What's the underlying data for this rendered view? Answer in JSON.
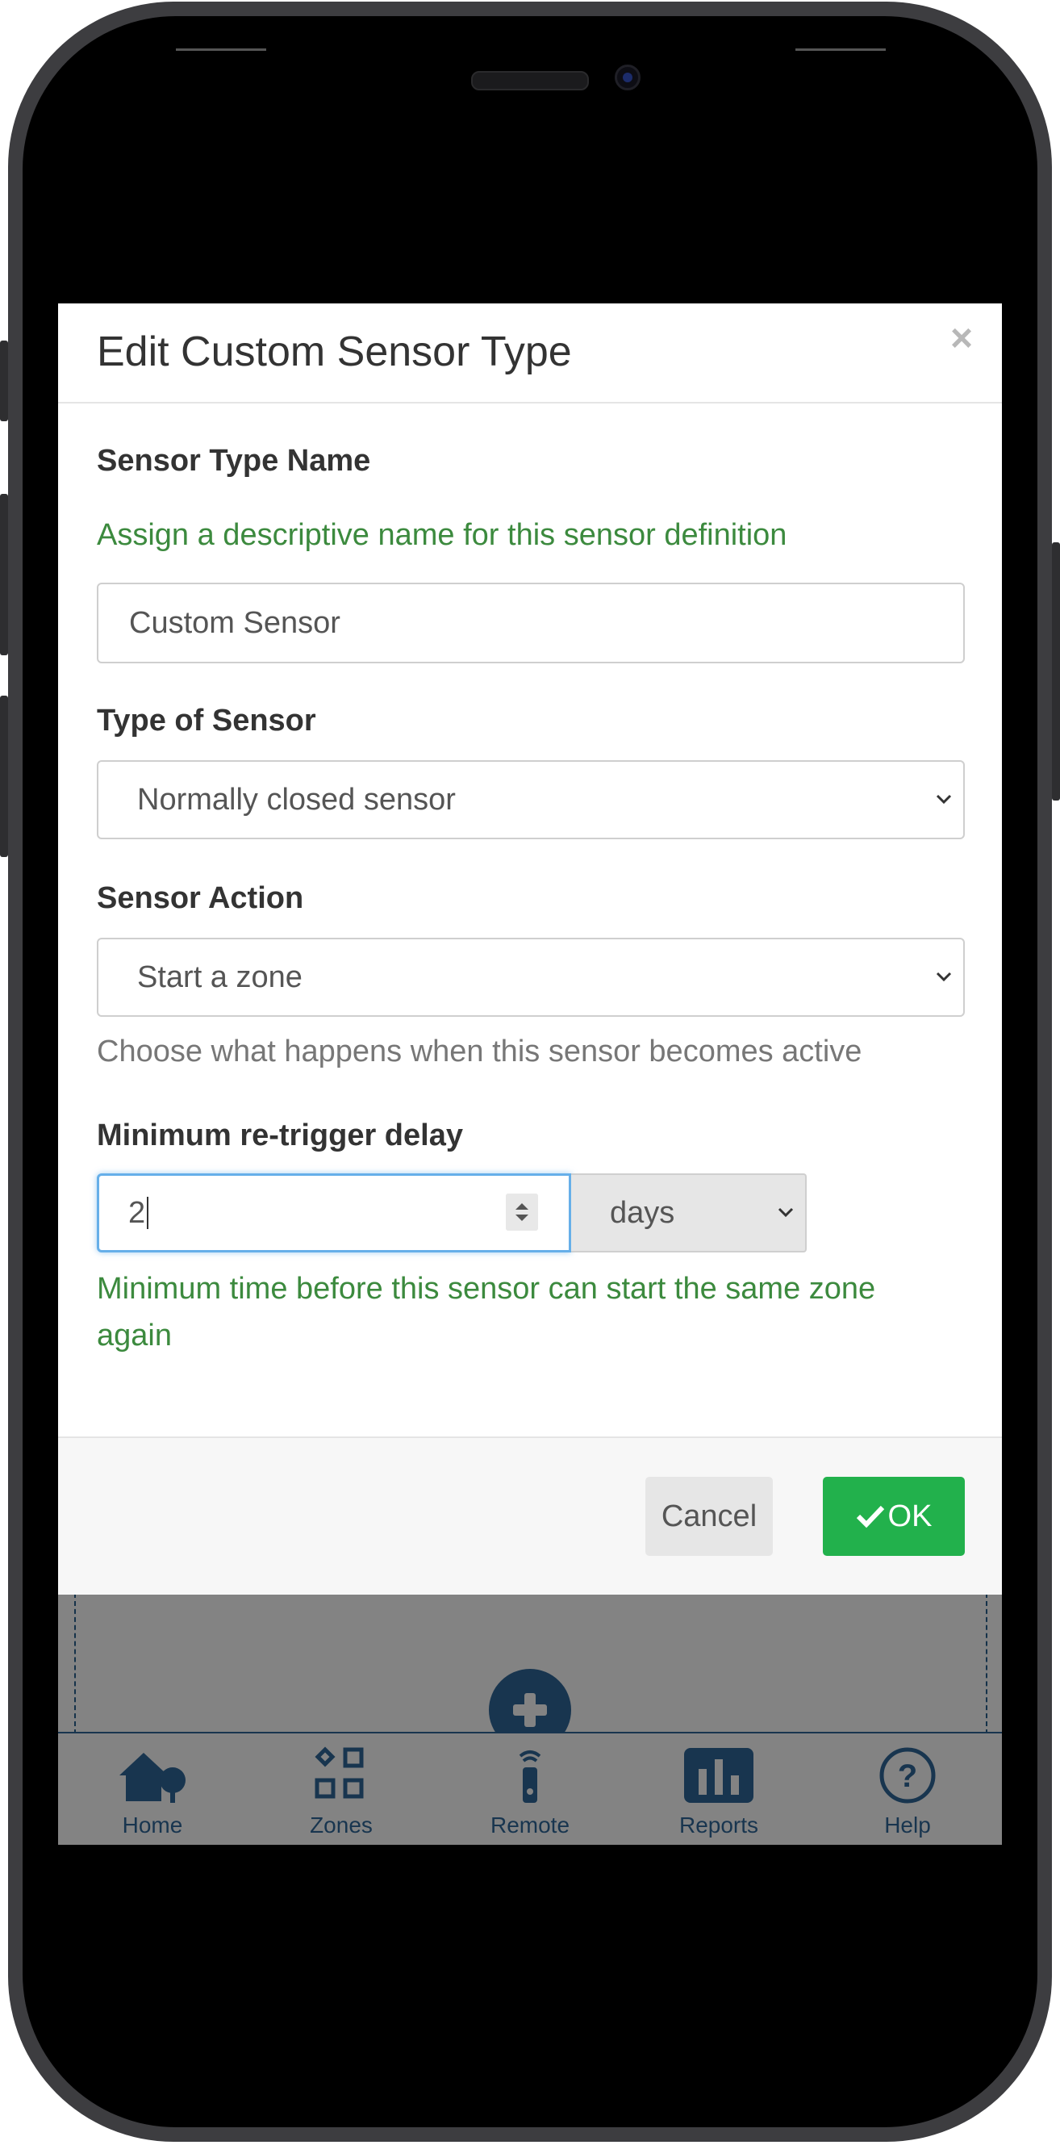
{
  "modal": {
    "title": "Edit Custom Sensor Type",
    "close_label": "×",
    "sensor_type_name": {
      "label": "Sensor Type Name",
      "help": "Assign a descriptive name for this sensor definition",
      "value": "Custom Sensor"
    },
    "type_of_sensor": {
      "label": "Type of Sensor",
      "selected": "Normally closed sensor"
    },
    "sensor_action": {
      "label": "Sensor Action",
      "selected": "Start a zone",
      "help": "Choose what happens when this sensor becomes active"
    },
    "retrigger_delay": {
      "label": "Minimum re-trigger delay",
      "value": "2",
      "unit": "days",
      "help_line1": "Minimum time before this sensor can start the same zone",
      "help_line2": "again"
    },
    "footer": {
      "cancel_label": "Cancel",
      "ok_label": "OK"
    }
  },
  "tabbar": {
    "items": [
      {
        "label": "Home",
        "icon": "home-icon"
      },
      {
        "label": "Zones",
        "icon": "zones-icon"
      },
      {
        "label": "Remote",
        "icon": "remote-icon"
      },
      {
        "label": "Reports",
        "icon": "reports-icon"
      },
      {
        "label": "Help",
        "icon": "help-icon"
      }
    ]
  },
  "colors": {
    "ok_button": "#22b14c",
    "help_text_green": "#3c8a3e",
    "nav_icon": "#18354f",
    "overlay": "#838383"
  }
}
